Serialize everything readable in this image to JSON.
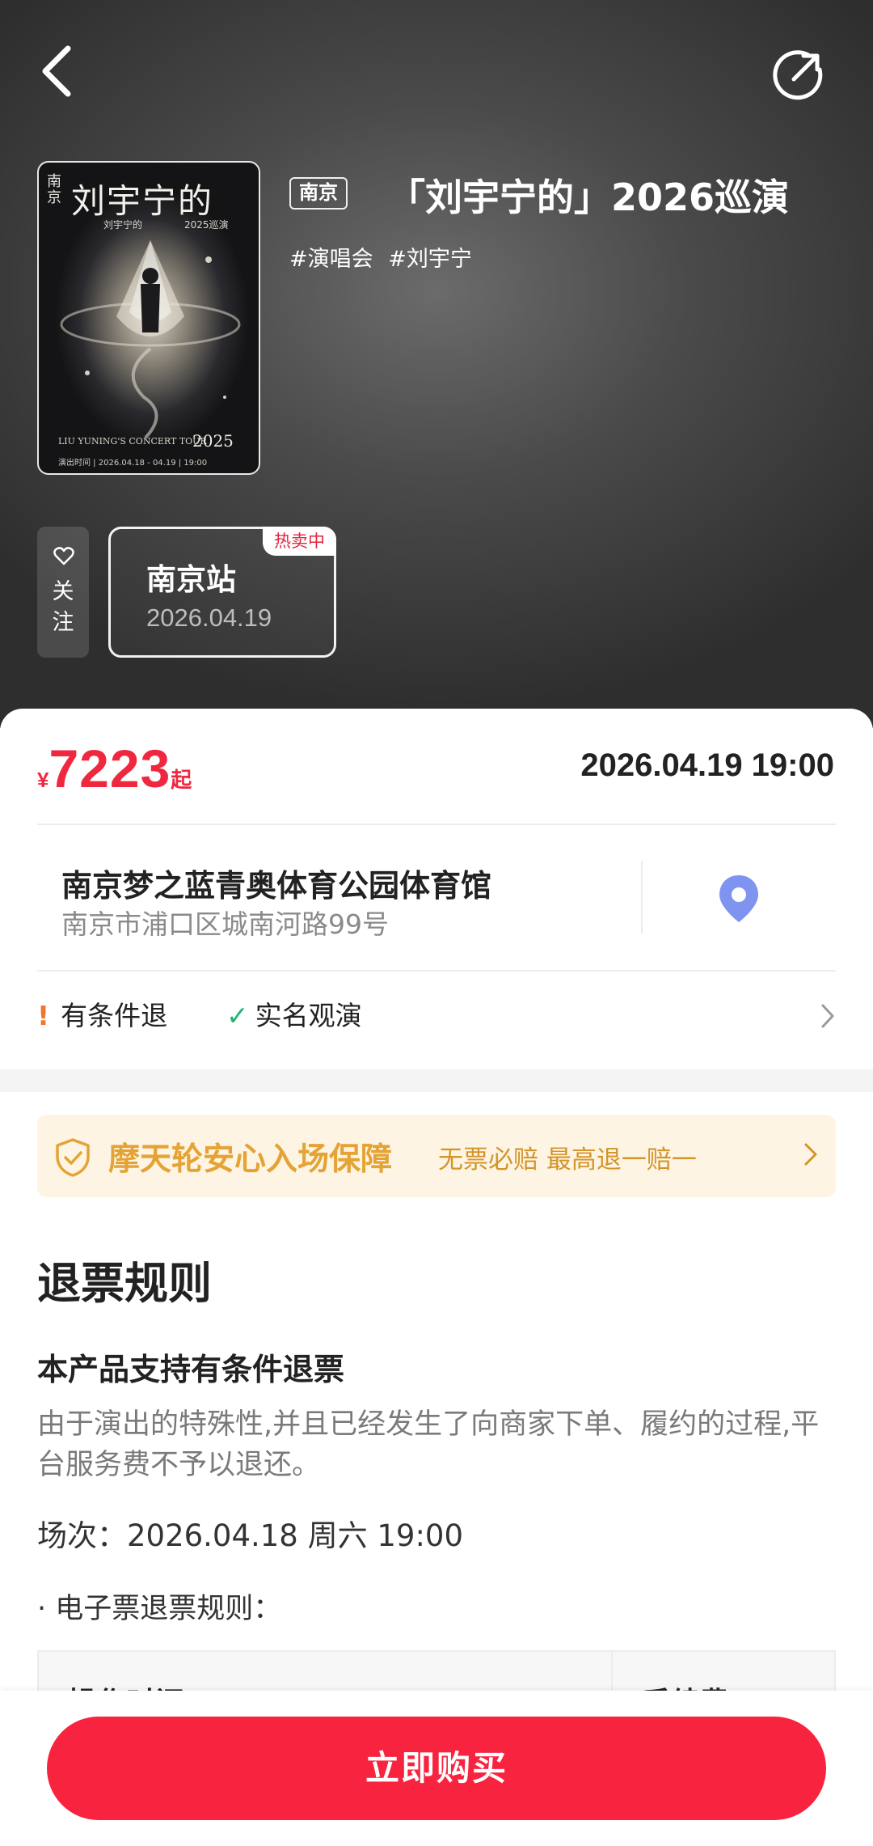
{
  "header": {
    "back_icon": "chevron-left-icon",
    "share_icon": "share-icon"
  },
  "poster": {
    "city": "南京",
    "title": "刘宇宁的",
    "subtitle": "刘宇宁的",
    "year_small": "2025巡演",
    "tour_line": "LIU YUNING'S CONCERT TOUR",
    "year": "2025",
    "date_line": "演出时间 | 2026.04.18 - 04.19 | 19:00"
  },
  "show": {
    "city_tag": "南京",
    "title": "「刘宇宁的」2026巡演",
    "tags": [
      "#演唱会",
      "#刘宇宁"
    ]
  },
  "follow": {
    "icon": "heart-icon",
    "label_1": "关",
    "label_2": "注"
  },
  "session": {
    "badge": "热卖中",
    "name": "南京站",
    "date": "2026.04.19"
  },
  "price": {
    "currency": "¥",
    "amount": "7223",
    "suffix": "起"
  },
  "datetime": "2026.04.19 19:00",
  "venue": {
    "name": "南京梦之蓝青奥体育公园体育馆",
    "address": "南京市浦口区城南河路99号",
    "pin_icon": "map-pin-icon"
  },
  "rules": {
    "conditional_refund": "有条件退",
    "real_name": "实名观演"
  },
  "guarantee": {
    "title": "摩天轮安心入场保障",
    "subtitle": "无票必赔  最高退一赔一"
  },
  "refund_rules": {
    "title": "退票规则",
    "subtitle": "本产品支持有条件退票",
    "description": "由于演出的特殊性,并且已经发生了向商家下单、履约的过程,平台服务费不予以退还。",
    "session": "场次：2026.04.18 周六 19:00",
    "eticket": "· 电子票退票规则：",
    "table_headers": [
      "操作时间",
      "手续费"
    ]
  },
  "buy_button": "立即购买",
  "colors": {
    "accent_red": "#f8233f",
    "price_red": "#f0283f",
    "guarantee_gold": "#e4a334",
    "pin_blue": "#7f93f0",
    "check_green": "#22b573"
  }
}
